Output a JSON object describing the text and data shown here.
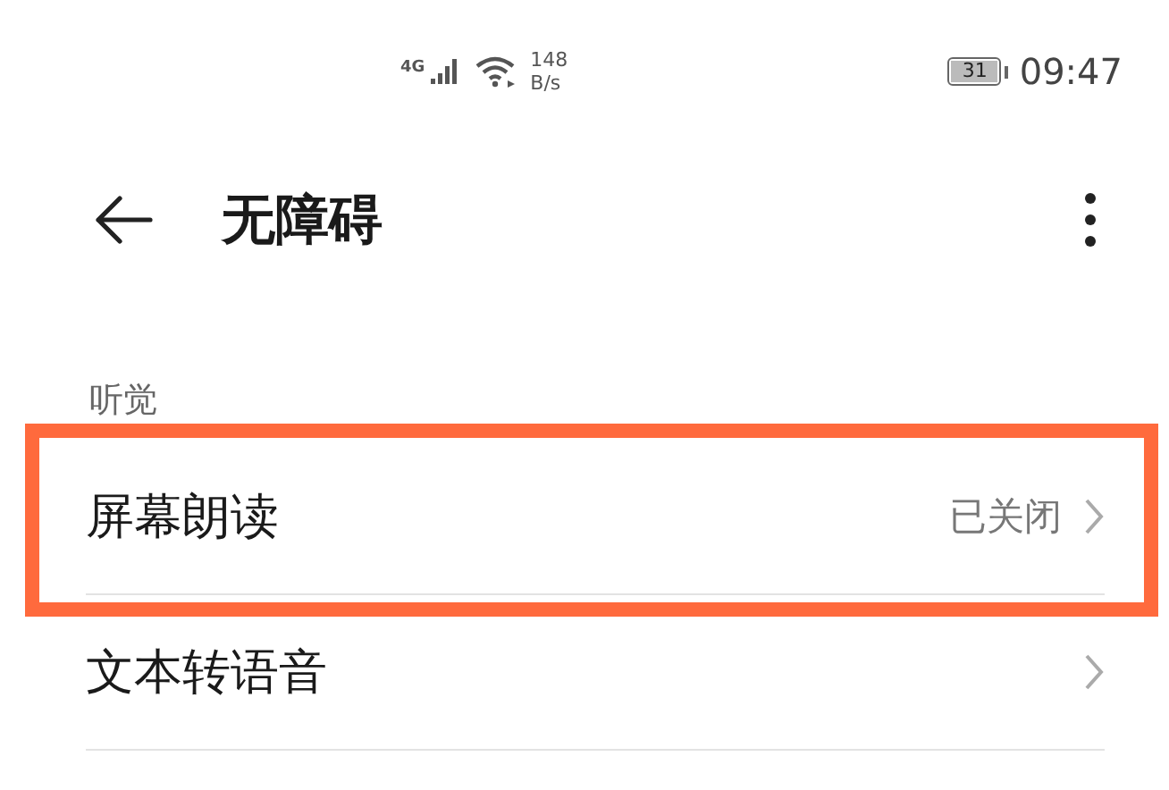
{
  "status_bar": {
    "network": "4G",
    "speed_value": "148",
    "speed_unit": "B/s",
    "battery": "31",
    "time": "09:47"
  },
  "header": {
    "title": "无障碍"
  },
  "section": {
    "title": "听觉"
  },
  "items": [
    {
      "label": "屏幕朗读",
      "value": "已关闭",
      "highlighted": true
    },
    {
      "label": "文本转语音",
      "highlighted": false
    }
  ]
}
